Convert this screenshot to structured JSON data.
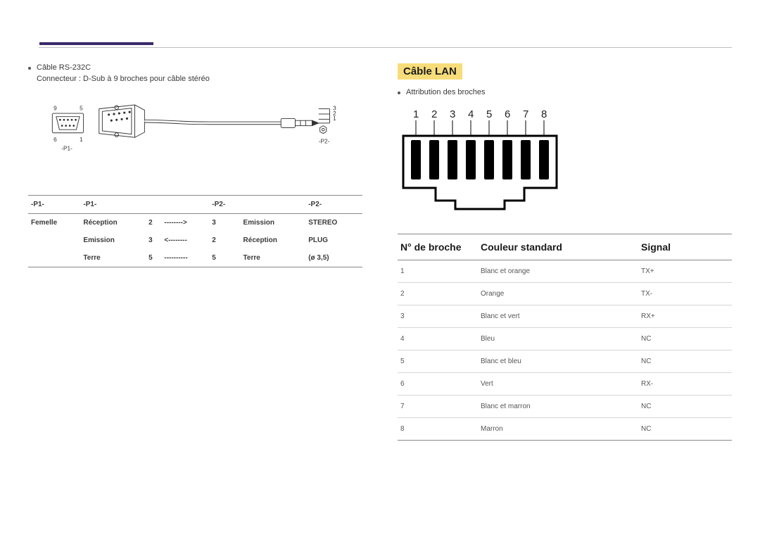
{
  "left": {
    "bullet1": "Câble RS-232C",
    "sub1": "Connecteur : D-Sub à 9 broches pour câble stéréo",
    "diagram": {
      "labels": {
        "nine": "9",
        "five": "5",
        "six": "6",
        "one": "1",
        "p1": "-P1-",
        "p2": "-P2-",
        "r3": "3",
        "r2": "2",
        "r1": "1"
      }
    },
    "table": {
      "header": [
        "-P1-",
        "-P1-",
        "",
        "",
        "-P2-",
        "",
        "-P2-"
      ],
      "rows": [
        [
          "Femelle",
          "Réception",
          "2",
          "-------->",
          "3",
          "Emission",
          "STEREO"
        ],
        [
          "",
          "Emission",
          "3",
          "<--------",
          "2",
          "Réception",
          "PLUG"
        ],
        [
          "",
          "Terre",
          "5",
          "----------",
          "5",
          "Terre",
          "(ø 3,5)"
        ]
      ]
    }
  },
  "right": {
    "heading": "Câble LAN",
    "bullet1": "Attribution des broches",
    "pin_numbers": [
      "1",
      "2",
      "3",
      "4",
      "5",
      "6",
      "7",
      "8"
    ],
    "table": {
      "headers": [
        "N° de broche",
        "Couleur standard",
        "Signal"
      ],
      "rows": [
        [
          "1",
          "Blanc et orange",
          "TX+"
        ],
        [
          "2",
          "Orange",
          "TX-"
        ],
        [
          "3",
          "Blanc et vert",
          "RX+"
        ],
        [
          "4",
          "Bleu",
          "NC"
        ],
        [
          "5",
          "Blanc et bleu",
          "NC"
        ],
        [
          "6",
          "Vert",
          "RX-"
        ],
        [
          "7",
          "Blanc et marron",
          "NC"
        ],
        [
          "8",
          "Marron",
          "NC"
        ]
      ]
    }
  }
}
